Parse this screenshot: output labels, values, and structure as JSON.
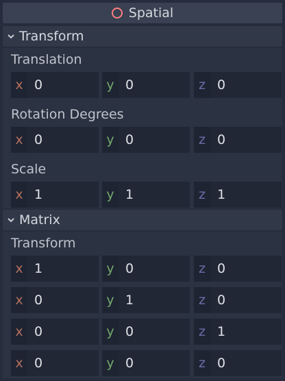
{
  "header": {
    "title": "Spatial"
  },
  "transform_section": {
    "label": "Transform"
  },
  "translation": {
    "label": "Translation",
    "x": "0",
    "y": "0",
    "z": "0"
  },
  "rotation": {
    "label": "Rotation Degrees",
    "x": "0",
    "y": "0",
    "z": "0"
  },
  "scale": {
    "label": "Scale",
    "x": "1",
    "y": "1",
    "z": "1"
  },
  "matrix_section": {
    "label": "Matrix"
  },
  "matrix": {
    "label": "Transform",
    "rows": [
      {
        "x": "1",
        "y": "0",
        "z": "0"
      },
      {
        "x": "0",
        "y": "1",
        "z": "0"
      },
      {
        "x": "0",
        "y": "0",
        "z": "1"
      },
      {
        "x": "0",
        "y": "0",
        "z": "0"
      }
    ]
  },
  "axes": {
    "x": "x",
    "y": "y",
    "z": "z"
  },
  "colors": {
    "axis_x": "#b5705f",
    "axis_y": "#73a86d",
    "axis_z": "#6b6ea8",
    "node_icon": "#fc7f7f"
  }
}
